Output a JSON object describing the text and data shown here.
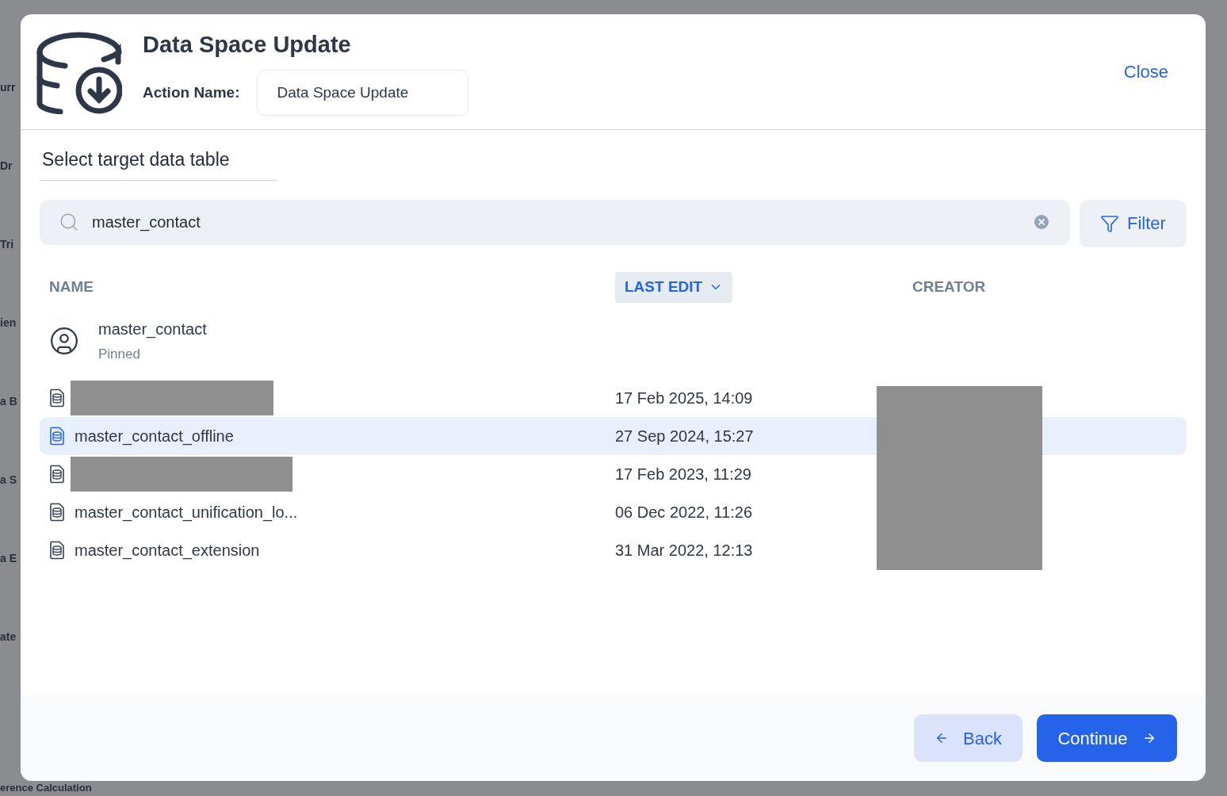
{
  "backdrop": {
    "fragments": [
      "urr",
      "Dr",
      "Tri",
      "ien",
      "a B",
      "a S",
      "a E",
      "ate"
    ],
    "footer_fragment": "erence Calculation"
  },
  "dialog": {
    "title": "Data Space Update",
    "action_label": "Action Name:",
    "action_value": "Data Space Update",
    "close": "Close"
  },
  "section_title": "Select target data table",
  "search": {
    "value": "master_contact"
  },
  "filter_button": "Filter",
  "table": {
    "columns": [
      {
        "label": "NAME",
        "sorted": false
      },
      {
        "label": "LAST EDIT",
        "sorted": true
      },
      {
        "label": "CREATOR",
        "sorted": false
      }
    ],
    "pinned": {
      "name": "master_contact",
      "tag": "Pinned"
    },
    "creator_redacted": true,
    "rows": [
      {
        "name": "",
        "redacted": true,
        "last_edit": "17 Feb 2025, 14:09",
        "selected": false
      },
      {
        "name": "master_contact_offline",
        "redacted": false,
        "last_edit": "27 Sep 2024, 15:27",
        "selected": true
      },
      {
        "name": "",
        "redacted": true,
        "last_edit": "17 Feb 2023, 11:29",
        "selected": false
      },
      {
        "name": "master_contact_unification_lo...",
        "redacted": false,
        "last_edit": "06 Dec 2022, 11:26",
        "selected": false
      },
      {
        "name": "master_contact_extension",
        "redacted": false,
        "last_edit": "31 Mar 2022, 12:13",
        "selected": false
      }
    ]
  },
  "footer": {
    "back": "Back",
    "continue": "Continue"
  }
}
